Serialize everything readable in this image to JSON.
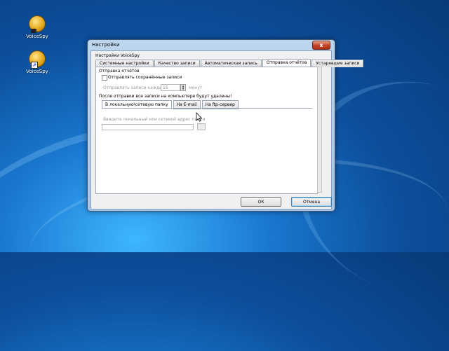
{
  "desktop": {
    "icons": [
      {
        "label": "VoiceSpy"
      },
      {
        "label": "VoiceSpy"
      }
    ]
  },
  "window": {
    "title": "Настройки",
    "close_symbol": "x",
    "group_label": "Настройки VoiceSpy",
    "tabs": [
      {
        "label": "Системные настройки"
      },
      {
        "label": "Качество записи"
      },
      {
        "label": "Автоматическая запись"
      },
      {
        "label": "Отправка отчётов"
      },
      {
        "label": "Устаревшие записи"
      }
    ],
    "panel": {
      "section_title": "Отправка отчётов",
      "send_checkbox_label": "Отправлять сохранённые записи",
      "interval_label": "Отправлять записи каждые",
      "interval_value": "15",
      "interval_unit": "минут",
      "note": "После отправки все записи на компьютере будут удалены!",
      "subtabs": [
        {
          "label": "В локальную\\сетевую папку"
        },
        {
          "label": "На E-mail"
        },
        {
          "label": "На ftp-сервер"
        }
      ],
      "path_label": "Введите локальный или сетевой адрес папки",
      "path_value": ""
    },
    "buttons": {
      "ok": "ОК",
      "cancel": "Отмена"
    }
  },
  "colors": {
    "accent": "#3c7fb1",
    "close": "#c4452a"
  }
}
